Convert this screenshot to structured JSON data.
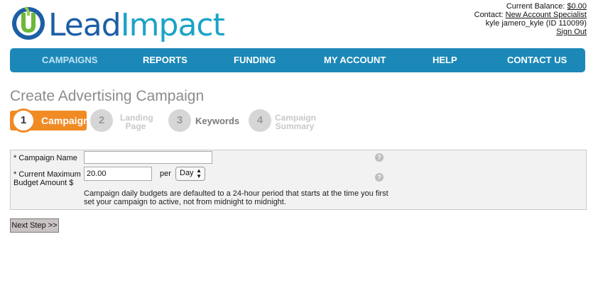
{
  "logo": {
    "part1": "Lead",
    "part2": "Impact"
  },
  "account": {
    "balance_label": "Current Balance:",
    "balance_value": "$0.00",
    "contact_label": "Contact:",
    "contact_value": "New Account Specialist",
    "user": "kyle jamero_kyle (ID 110099)",
    "signout": "Sign Out"
  },
  "nav": {
    "items": [
      {
        "label": "CAMPAIGNS",
        "active": true
      },
      {
        "label": "REPORTS"
      },
      {
        "label": "FUNDING"
      },
      {
        "label": "MY ACCOUNT"
      },
      {
        "label": "HELP"
      },
      {
        "label": "CONTACT US"
      }
    ]
  },
  "page_title": "Create Advertising Campaign",
  "steps": [
    {
      "num": "1",
      "label": "Campaign"
    },
    {
      "num": "2",
      "label_line1": "Landing",
      "label_line2": "Page"
    },
    {
      "num": "3",
      "label": "Keywords"
    },
    {
      "num": "4",
      "label_line1": "Campaign",
      "label_line2": "Summary"
    }
  ],
  "form": {
    "campaign_name_label": "* Campaign Name",
    "campaign_name_value": "",
    "budget_label_line1": "* Current Maximum",
    "budget_label_line2": "Budget Amount $",
    "budget_value": "20.00",
    "per_label": "per",
    "period_selected": "Day",
    "note_line1": "Campaign daily budgets are defaulted to a 24-hour period that starts at the time you first",
    "note_line2": "set your campaign to active, not from midnight to midnight.",
    "help_glyph": "?"
  },
  "next_button": "Next Step >>",
  "colors": {
    "nav": "#1c88b8",
    "accent": "#f08b24",
    "title": "#8c8c8c"
  }
}
